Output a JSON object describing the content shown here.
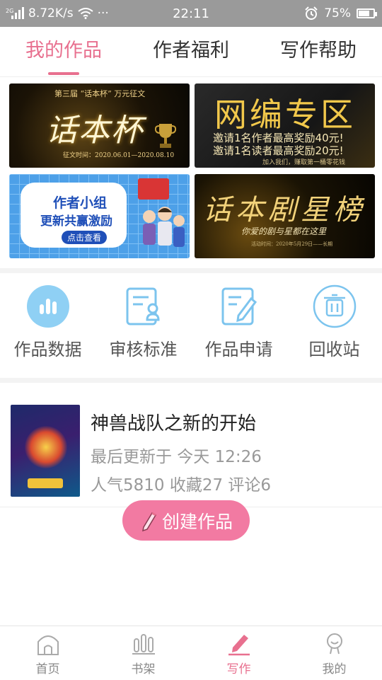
{
  "status_bar": {
    "network": "8.72K/s",
    "signal_label": "2G",
    "more": "···",
    "time": "22:11",
    "battery": "75%",
    "battery_level": 0.75
  },
  "tabs": [
    {
      "label": "我的作品",
      "active": true
    },
    {
      "label": "作者福利",
      "active": false
    },
    {
      "label": "写作帮助",
      "active": false
    }
  ],
  "banners": {
    "b1": {
      "sub": "第三届 “话本杯” 万元征文",
      "title": "话本杯",
      "date": "征文时间：2020.06.01—2020.08.10"
    },
    "b2": {
      "title": "网编专区",
      "line1": "邀请1名作者最高奖励40元!",
      "line2": "邀请1名读者最高奖励20元!",
      "line3": "加入我们，赚取第一桶零花钱"
    },
    "b3": {
      "title": "作者小组",
      "subtitle": "更新共赢激励",
      "button": "点击查看"
    },
    "b4": {
      "title": "话本剧星榜",
      "sub": "你爱的剧与星都在这里",
      "date": "活动时间：2020年5月29日——长期"
    }
  },
  "actions": [
    {
      "label": "作品数据",
      "icon": "bar-chart-icon"
    },
    {
      "label": "审核标准",
      "icon": "review-standard-icon"
    },
    {
      "label": "作品申请",
      "icon": "edit-document-icon"
    },
    {
      "label": "回收站",
      "icon": "trash-icon"
    }
  ],
  "work": {
    "name": "神兽战队之新的开始",
    "updated": "最后更新于 今天 12:26",
    "stats": "人气5810 收藏27 评论6"
  },
  "create_button": "创建作品",
  "bottom_nav": [
    {
      "label": "首页",
      "icon": "home-icon",
      "active": false
    },
    {
      "label": "书架",
      "icon": "bookshelf-icon",
      "active": false
    },
    {
      "label": "写作",
      "icon": "pen-icon",
      "active": true
    },
    {
      "label": "我的",
      "icon": "profile-icon",
      "active": false
    }
  ],
  "colors": {
    "accent": "#e8708f",
    "button": "#f27aa2",
    "icon_blue": "#7cc4ee"
  }
}
